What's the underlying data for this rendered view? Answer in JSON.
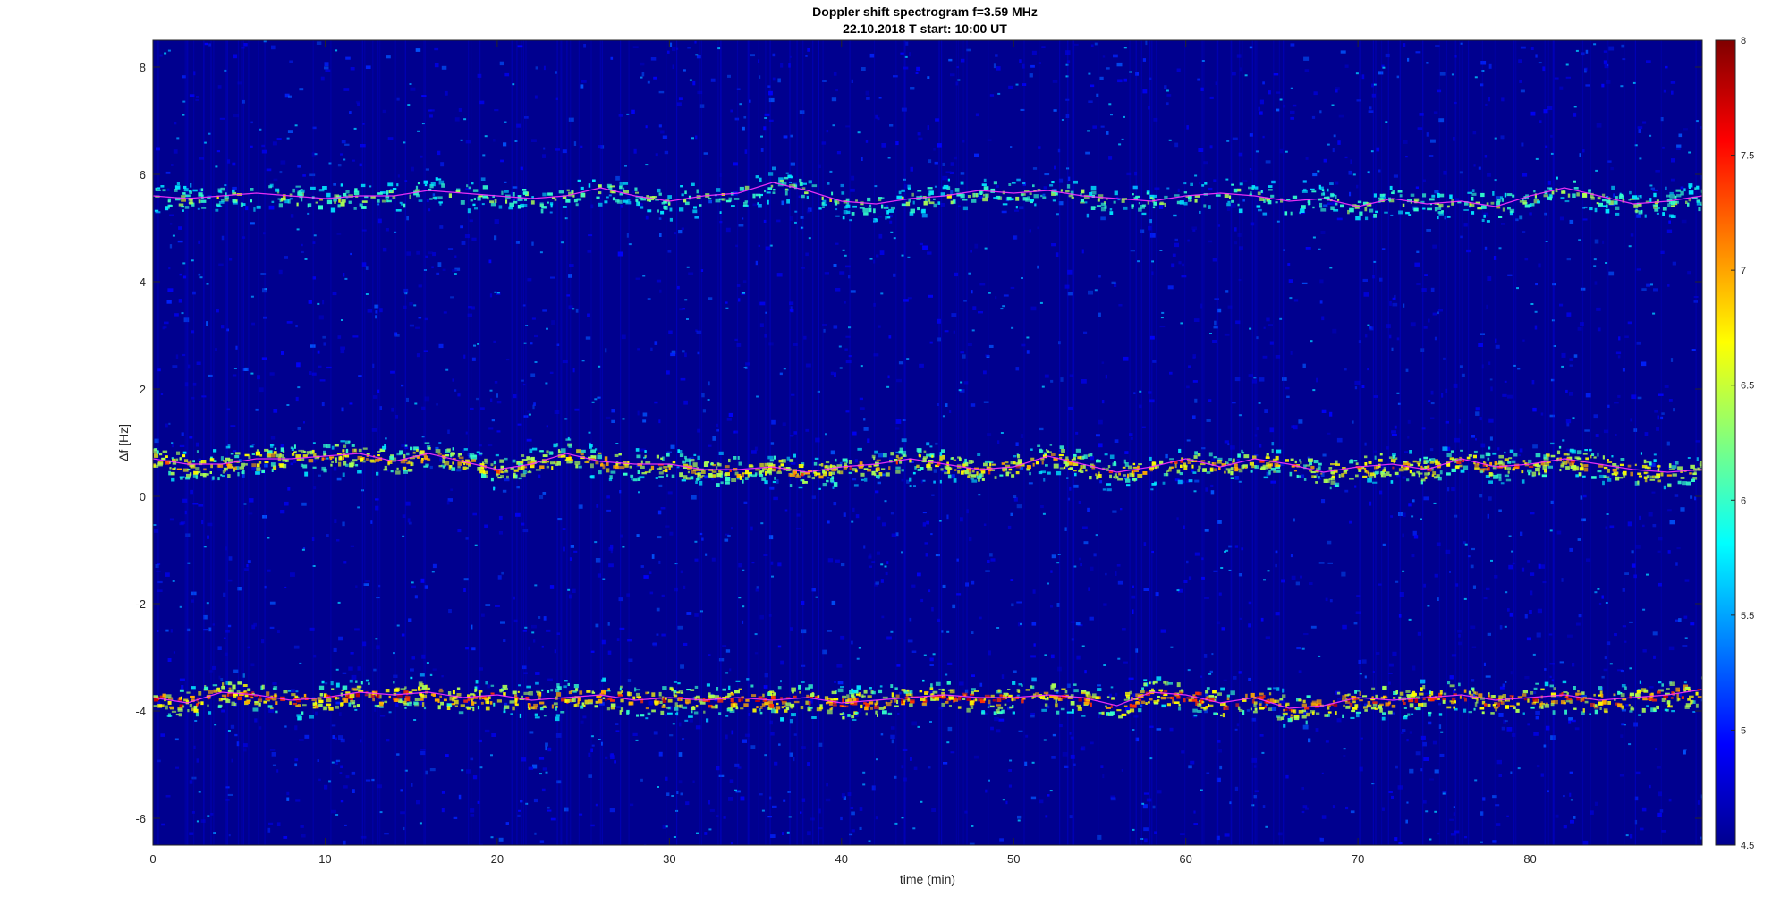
{
  "chart_data": {
    "type": "heatmap",
    "title": "Doppler shift spectrogram f=3.59 MHz",
    "subtitle": "22.10.2018   T start: 10:00 UT",
    "xlabel": "time (min)",
    "ylabel": "Δf [Hz]",
    "xlim": [
      0,
      90
    ],
    "ylim": [
      -6.5,
      8.5
    ],
    "x_ticks": [
      0,
      10,
      20,
      30,
      40,
      50,
      60,
      70,
      80
    ],
    "y_ticks": [
      -6,
      -4,
      -2,
      0,
      2,
      4,
      6,
      8
    ],
    "colorbar": {
      "colormap": "jet",
      "range": [
        4.5,
        8
      ],
      "ticks": [
        "4.5",
        "5",
        "5.5",
        "6",
        "6.5",
        "7",
        "7.5",
        "8"
      ]
    },
    "grid": false,
    "background_color": "#00008f",
    "traces": [
      {
        "color": "#ff33ff",
        "x": [
          0,
          2,
          4,
          6,
          8,
          10,
          12,
          14,
          16,
          18,
          20,
          22,
          24,
          26,
          28,
          30,
          32,
          34,
          36,
          38,
          40,
          42,
          44,
          46,
          48,
          50,
          52,
          54,
          56,
          58,
          60,
          62,
          64,
          66,
          68,
          70,
          72,
          74,
          76,
          78,
          80,
          82,
          84,
          86,
          88,
          90
        ],
        "y": [
          5.6,
          5.55,
          5.6,
          5.65,
          5.6,
          5.55,
          5.6,
          5.6,
          5.7,
          5.65,
          5.6,
          5.55,
          5.6,
          5.75,
          5.6,
          5.5,
          5.6,
          5.65,
          5.85,
          5.7,
          5.5,
          5.45,
          5.55,
          5.6,
          5.7,
          5.65,
          5.7,
          5.6,
          5.55,
          5.5,
          5.6,
          5.65,
          5.6,
          5.5,
          5.55,
          5.4,
          5.55,
          5.45,
          5.5,
          5.4,
          5.6,
          5.75,
          5.6,
          5.45,
          5.5,
          5.6
        ]
      },
      {
        "color": "#ff33ff",
        "x": [
          0,
          2,
          4,
          6,
          8,
          10,
          12,
          14,
          16,
          18,
          20,
          22,
          24,
          26,
          28,
          30,
          32,
          34,
          36,
          38,
          40,
          42,
          44,
          46,
          48,
          50,
          52,
          54,
          56,
          58,
          60,
          62,
          64,
          66,
          68,
          70,
          72,
          74,
          76,
          78,
          80,
          82,
          84,
          86,
          88,
          90
        ],
        "y": [
          0.7,
          0.6,
          0.6,
          0.7,
          0.7,
          0.75,
          0.8,
          0.65,
          0.8,
          0.65,
          0.5,
          0.6,
          0.8,
          0.65,
          0.6,
          0.6,
          0.5,
          0.5,
          0.55,
          0.45,
          0.55,
          0.6,
          0.7,
          0.6,
          0.5,
          0.55,
          0.75,
          0.6,
          0.45,
          0.55,
          0.7,
          0.55,
          0.7,
          0.6,
          0.45,
          0.55,
          0.6,
          0.5,
          0.7,
          0.55,
          0.6,
          0.7,
          0.6,
          0.5,
          0.45,
          0.5
        ]
      },
      {
        "color": "#ff33ff",
        "x": [
          0,
          2,
          4,
          6,
          8,
          10,
          12,
          14,
          16,
          18,
          20,
          22,
          24,
          26,
          28,
          30,
          32,
          34,
          36,
          38,
          40,
          42,
          44,
          46,
          48,
          50,
          52,
          54,
          56,
          58,
          60,
          62,
          64,
          66,
          68,
          70,
          72,
          74,
          76,
          78,
          80,
          82,
          84,
          86,
          88,
          90
        ],
        "y": [
          -3.75,
          -3.85,
          -3.65,
          -3.7,
          -3.8,
          -3.75,
          -3.65,
          -3.7,
          -3.65,
          -3.75,
          -3.7,
          -3.8,
          -3.75,
          -3.7,
          -3.8,
          -3.75,
          -3.8,
          -3.75,
          -3.8,
          -3.75,
          -3.85,
          -3.8,
          -3.75,
          -3.7,
          -3.75,
          -3.75,
          -3.7,
          -3.75,
          -3.9,
          -3.65,
          -3.7,
          -3.85,
          -3.75,
          -3.95,
          -3.9,
          -3.75,
          -3.8,
          -3.75,
          -3.7,
          -3.8,
          -3.75,
          -3.7,
          -3.8,
          -3.75,
          -3.7,
          -3.6
        ]
      }
    ]
  }
}
